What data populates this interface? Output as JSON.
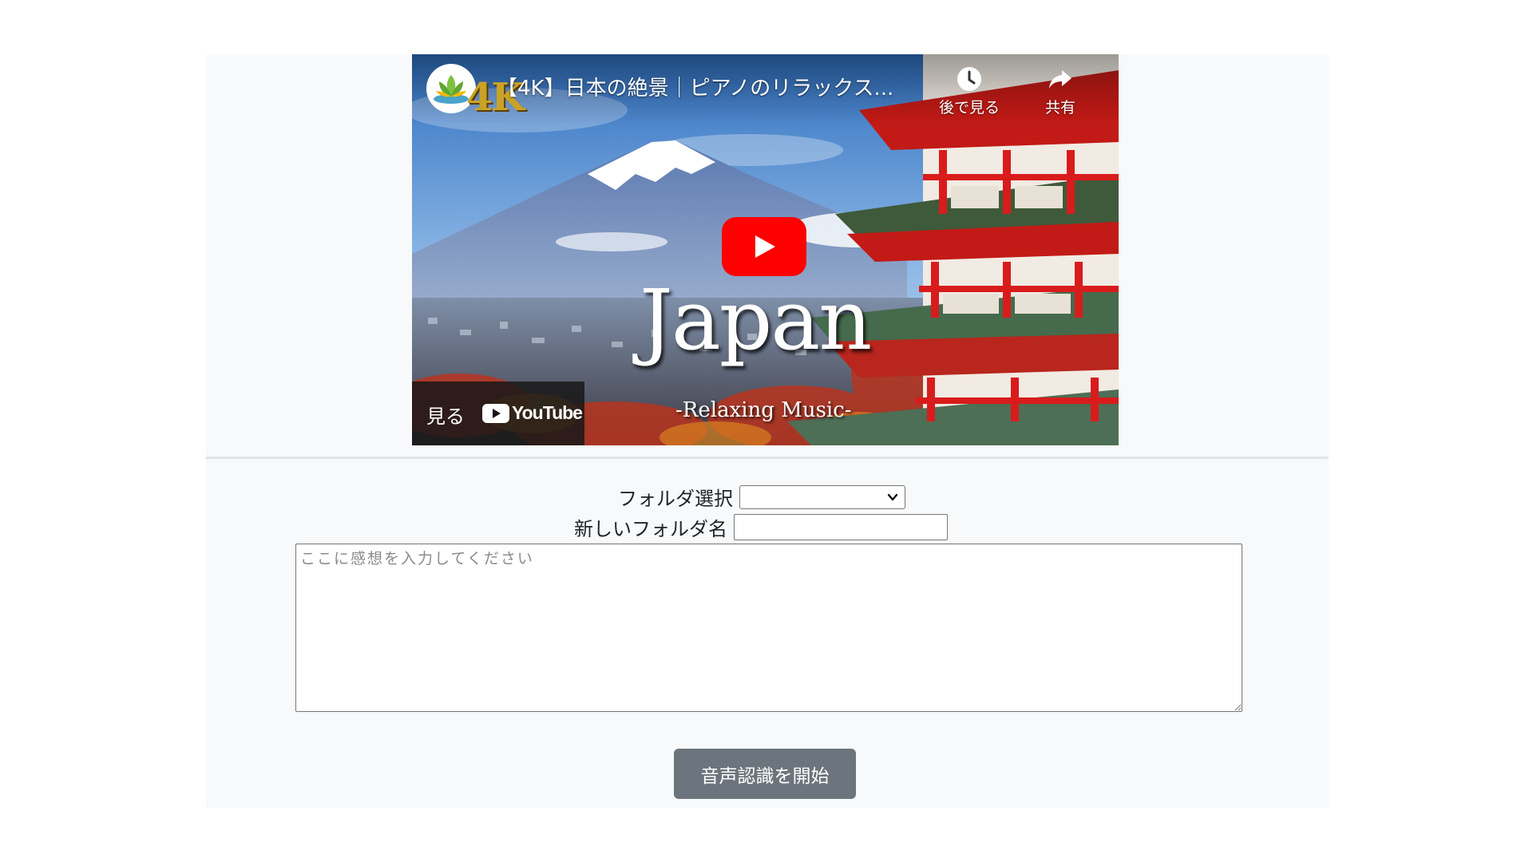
{
  "video": {
    "title": "【4K】日本の絶景｜ピアノのリラックス...",
    "brand_badge": "4K",
    "overlay_title": "Japan",
    "overlay_subtitle": "-Relaxing Music-",
    "watch_later_label": "後で見る",
    "share_label": "共有",
    "watch_on_label": "見る",
    "youtube_wordmark": "YouTube",
    "icons": {
      "watch_later": "clock-icon",
      "share": "share-arrow-icon",
      "play": "play-icon",
      "channel": "lotus-logo-icon"
    },
    "colors": {
      "play_button": "#ff0000",
      "pagoda_red": "#d81c1c"
    }
  },
  "form": {
    "folder_select_label": "フォルダ選択",
    "folder_select_value": "",
    "new_folder_label": "新しいフォルダ名",
    "new_folder_value": "",
    "impression_placeholder": "ここに感想を入力してください",
    "impression_value": "",
    "start_button_label": "音声認識を開始",
    "colors": {
      "button_bg": "#6c757d",
      "panel_bg": "#f8f9fa"
    }
  }
}
